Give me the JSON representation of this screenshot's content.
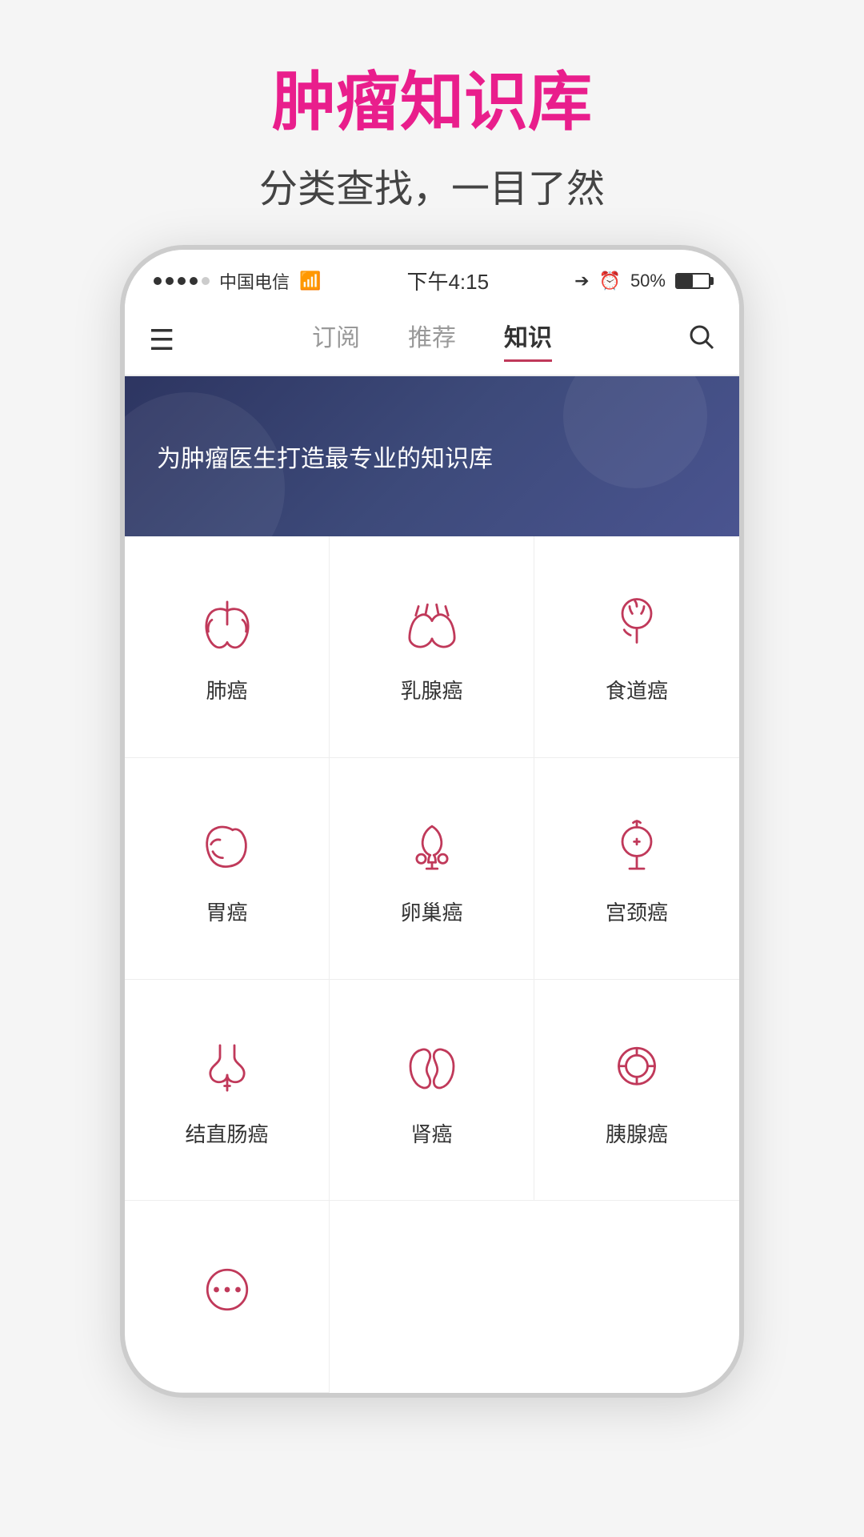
{
  "page": {
    "title_main": "肿瘤知识库",
    "title_sub": "分类查找，一目了然"
  },
  "status_bar": {
    "carrier": "中国电信",
    "wifi": "WiFi",
    "time": "下午4:15",
    "battery_percent": "50%"
  },
  "nav": {
    "tabs": [
      {
        "label": "订阅",
        "active": false
      },
      {
        "label": "推荐",
        "active": false
      },
      {
        "label": "知识",
        "active": true
      }
    ]
  },
  "banner": {
    "text": "为肿瘤医生打造最专业的知识库"
  },
  "categories": [
    {
      "id": 1,
      "label": "肺癌",
      "icon": "lung"
    },
    {
      "id": 2,
      "label": "乳腺癌",
      "icon": "breast"
    },
    {
      "id": 3,
      "label": "食道癌",
      "icon": "esophagus"
    },
    {
      "id": 4,
      "label": "胃癌",
      "icon": "stomach"
    },
    {
      "id": 5,
      "label": "卵巢癌",
      "icon": "ovary"
    },
    {
      "id": 6,
      "label": "宫颈癌",
      "icon": "cervix"
    },
    {
      "id": 7,
      "label": "结直肠癌",
      "icon": "colon"
    },
    {
      "id": 8,
      "label": "肾癌",
      "icon": "kidney"
    },
    {
      "id": 9,
      "label": "胰腺癌",
      "icon": "pancreas"
    },
    {
      "id": 10,
      "label": "",
      "icon": "more"
    }
  ]
}
